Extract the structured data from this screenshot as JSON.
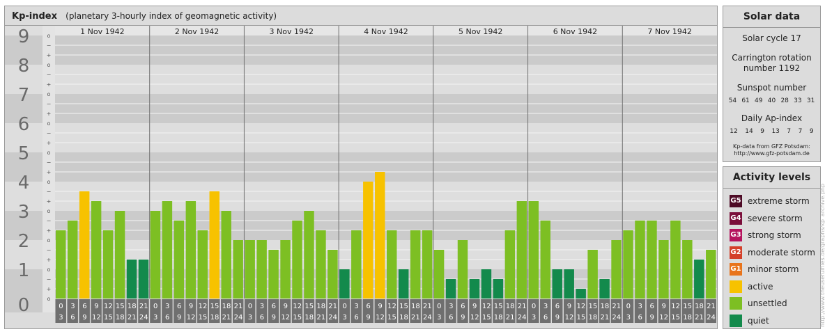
{
  "header": {
    "title": "Kp-index",
    "subtitle": "(planetary 3-hourly index of geomagnetic activity)"
  },
  "chart_data": {
    "type": "bar",
    "title": "Kp-index",
    "subtitle": "(planetary 3-hourly index of geomagnetic activity)",
    "days": [
      "1 Nov 1942",
      "2 Nov 1942",
      "3 Nov 1942",
      "4 Nov 1942",
      "5 Nov 1942",
      "6 Nov 1942",
      "7 Nov 1942"
    ],
    "interval_labels": [
      [
        "0",
        "3"
      ],
      [
        "3",
        "6"
      ],
      [
        "6",
        "9"
      ],
      [
        "9",
        "12"
      ],
      [
        "12",
        "15"
      ],
      [
        "15",
        "18"
      ],
      [
        "18",
        "21"
      ],
      [
        "21",
        "24"
      ]
    ],
    "ylim": [
      0,
      9
    ],
    "y_ticks": [
      "0",
      "1",
      "2",
      "3",
      "4",
      "5",
      "6",
      "7",
      "8",
      "9"
    ],
    "sub_ticks": [
      "+",
      "o",
      "−"
    ],
    "values": [
      2.333,
      2.667,
      3.667,
      3.333,
      2.333,
      3.0,
      1.333,
      1.333,
      3.0,
      3.333,
      2.667,
      3.333,
      2.333,
      3.667,
      3.0,
      2.0,
      2.0,
      2.0,
      1.667,
      2.0,
      2.667,
      3.0,
      2.333,
      1.667,
      1.0,
      2.333,
      4.0,
      4.333,
      2.333,
      1.0,
      2.333,
      2.333,
      1.667,
      0.667,
      2.0,
      0.667,
      1.0,
      0.667,
      2.333,
      3.333,
      3.333,
      2.667,
      1.0,
      1.0,
      0.333,
      1.667,
      0.667,
      2.0,
      2.333,
      2.667,
      2.667,
      2.0,
      2.667,
      2.0,
      1.333,
      1.667
    ],
    "colors": {
      "quiet": "#138a4c",
      "unsettled": "#7dbf23",
      "active": "#f7c200"
    },
    "category_thresholds": {
      "unsettled_min": 1.667,
      "active_min": 3.667
    }
  },
  "solar": {
    "title": "Solar data",
    "cycle": "Solar cycle 17",
    "carrington_line1": "Carrington rotation",
    "carrington_line2": "number 1192",
    "sunspot_label": "Sunspot number",
    "sunspot_values": [
      "54",
      "61",
      "49",
      "40",
      "28",
      "33",
      "31"
    ],
    "ap_label": "Daily Ap-index",
    "ap_values": [
      "12",
      "14",
      "9",
      "13",
      "7",
      "7",
      "9"
    ],
    "credit_line1": "Kp-data from GFZ Potsdam:",
    "credit_line2": "http://www.gfz-potsdam.de"
  },
  "activity": {
    "title": "Activity levels",
    "levels": [
      {
        "badge": "G5",
        "label": "extreme storm",
        "color": "#4d0a25"
      },
      {
        "badge": "G4",
        "label": "severe storm",
        "color": "#7a0e3a"
      },
      {
        "badge": "G3",
        "label": "strong storm",
        "color": "#b5145e"
      },
      {
        "badge": "G2",
        "label": "moderate storm",
        "color": "#d4402a"
      },
      {
        "badge": "G1",
        "label": "minor storm",
        "color": "#e8741c"
      },
      {
        "badge": "",
        "label": "active",
        "color": "#f7c200"
      },
      {
        "badge": "",
        "label": "unsettled",
        "color": "#7dbf23"
      },
      {
        "badge": "",
        "label": "quiet",
        "color": "#138a4c"
      }
    ]
  },
  "watermark": "http://www.theusefulfiles.de/graphs/kp_archive.php"
}
